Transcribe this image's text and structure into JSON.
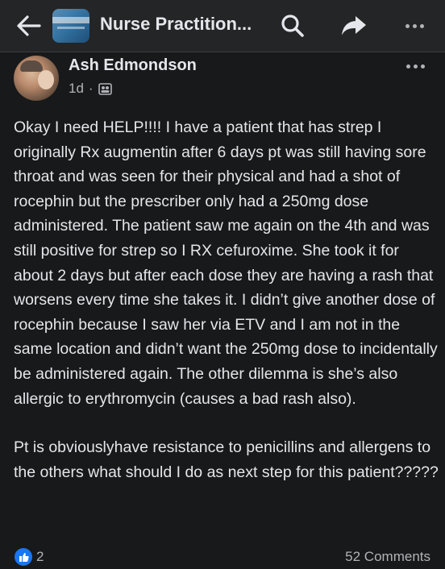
{
  "header": {
    "group_title": "Nurse Practition...",
    "icons": {
      "back": "arrow-left-icon",
      "group": "group-thumbnail",
      "search": "search-icon",
      "share": "share-arrow-icon",
      "more": "more-dots-icon"
    }
  },
  "post": {
    "author": "Ash Edmondson",
    "time": "1d",
    "separator": "·",
    "audience_icon": "group-audience-icon",
    "paragraphs": [
      "Okay I need HELP!!!! I have a patient that has strep I originally Rx augmentin after 6 days pt was still having sore throat and was seen for their physical and had a shot of rocephin but the prescriber only had a 250mg dose administered. The patient saw me again on the 4th and was still positive for strep so I RX cefuroxime. She took it for about 2 days but after each dose they are having a rash that worsens every time she takes it. I didn’t give another dose of rocephin because I saw her via ETV and I am not in the same location and didn’t want the 250mg dose to incidentally be administered again. The other dilemma is she’s also allergic to erythromycin (causes a bad rash also).",
      "Pt is obviouslyhave resistance to penicillins and allergens to the others what should I do as next step for this patient?????"
    ],
    "reactions": {
      "like_icon": "like-thumb-icon",
      "count": "2"
    },
    "comments": "52 Comments"
  },
  "colors": {
    "background": "#18191a",
    "topbar": "#242526",
    "text": "#e4e6eb",
    "secondary_text": "#b0b3b8",
    "like_blue": "#1877f2"
  }
}
